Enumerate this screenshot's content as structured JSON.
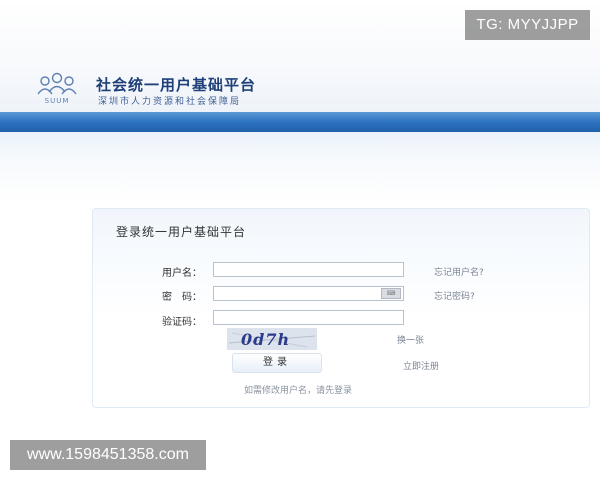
{
  "header": {
    "logo_text": "SUUM",
    "title": "社会统一用户基础平台",
    "subtitle": "深圳市人力资源和社会保障局"
  },
  "login": {
    "panel_title": "登录统一用户基础平台",
    "username_label": "用户名：",
    "username_value": "",
    "forgot_username": "忘记用户名?",
    "password_label": "密　码：",
    "password_value": "",
    "keyboard_icon": "keyboard-icon",
    "forgot_password": "忘记密码?",
    "captcha_label": "验证码：",
    "captcha_value": "",
    "captcha_text": "0d7h",
    "refresh_captcha": "换一张",
    "login_button": "登录",
    "register_link": "立即注册",
    "hint": "如需修改用户名，请先登录"
  },
  "watermarks": {
    "tag": "TG: MYYJJPP",
    "url": "www.1598451358.com"
  },
  "colors": {
    "brand": "#1f3f78",
    "stripe": "#2d73bf",
    "link": "#7c8594"
  }
}
